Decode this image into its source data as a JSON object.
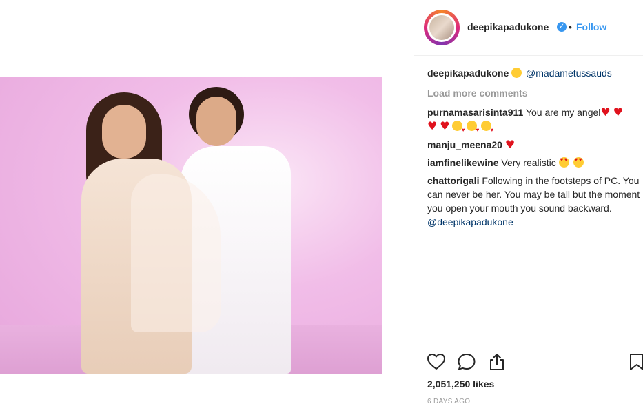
{
  "post": {
    "username": "deepikapadukone",
    "follow_label": "Follow",
    "dot": "•",
    "verified_glyph": "✓"
  },
  "caption": {
    "username": "deepikapadukone",
    "emoji": "😛",
    "mention": "@madametussauds"
  },
  "load_more_label": "Load more comments",
  "comments": [
    {
      "username": "purnamasarisinta911",
      "text": "You are my angel"
    },
    {
      "username": "manju_meena20",
      "text": ""
    },
    {
      "username": "iamfinelikewine",
      "text": "Very realistic"
    },
    {
      "username": "chattorigali",
      "text": "Following in the footsteps of PC. You can never be her. You may be tall but the moment you open your mouth you sound backward.",
      "mention": "@deepikapadukone"
    }
  ],
  "actions": {
    "icons": [
      "heart-outline-icon",
      "comment-icon",
      "share-icon",
      "bookmark-icon"
    ]
  },
  "likes_text": "2,051,250 likes",
  "timestamp": "6 DAYS AGO",
  "colors": {
    "accent": "#3897f0",
    "text": "#262626",
    "muted": "#999999",
    "mention": "#003569"
  }
}
